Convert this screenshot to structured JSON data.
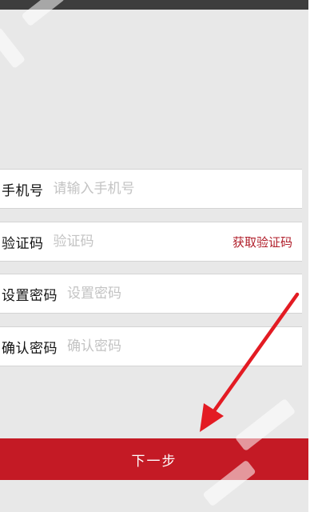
{
  "form": {
    "phone": {
      "label": "手机号",
      "placeholder": "请输入手机号",
      "value": ""
    },
    "code": {
      "label": "验证码",
      "placeholder": "验证码",
      "value": "",
      "action": "获取验证码"
    },
    "password": {
      "label": "设置密码",
      "placeholder": "设置密码",
      "value": ""
    },
    "confirm": {
      "label": "确认密码",
      "placeholder": "确认密码",
      "value": ""
    }
  },
  "next_button": {
    "label": "下一步"
  },
  "colors": {
    "primary": "#c41a25",
    "background": "#e8e8e8",
    "placeholder": "#c3c3c3",
    "arrow": "#e31b23"
  },
  "icons": {
    "annotation": "red-arrow-icon"
  }
}
